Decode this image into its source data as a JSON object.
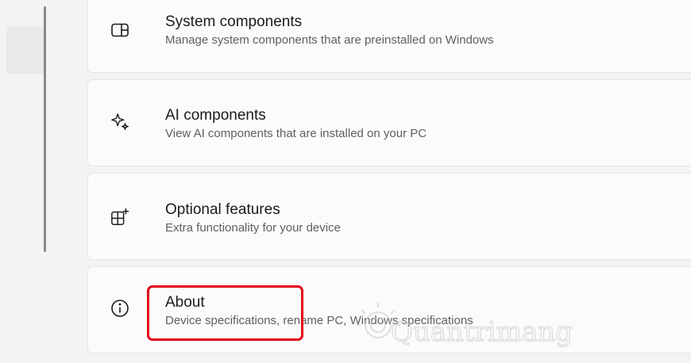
{
  "cards": [
    {
      "title": "System components",
      "description": "Manage system components that are preinstalled on Windows",
      "icon": "system-components-icon"
    },
    {
      "title": "AI components",
      "description": "View AI components that are installed on your PC",
      "icon": "sparkle-icon"
    },
    {
      "title": "Optional features",
      "description": "Extra functionality for your device",
      "icon": "optional-features-icon"
    },
    {
      "title": "About",
      "description": "Device specifications, rename PC, Windows specifications",
      "icon": "info-icon"
    }
  ],
  "highlight_color": "#e2001a",
  "watermark_text": "Quantrimang"
}
